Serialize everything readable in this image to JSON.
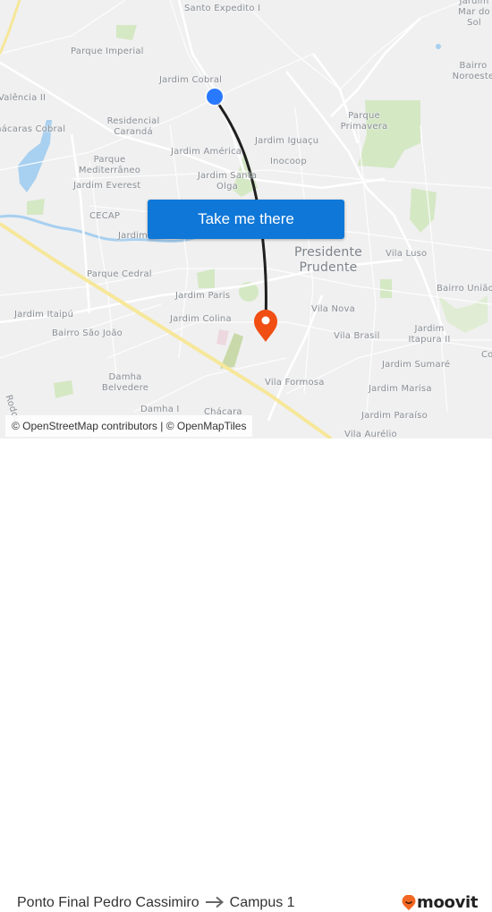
{
  "map": {
    "labels": [
      {
        "text": "Santo Expedito I",
        "kind": "suburb"
      },
      {
        "text": "Jardim Mar do Sol",
        "kind": "suburb"
      },
      {
        "text": "Parque Imperial",
        "kind": "suburb"
      },
      {
        "text": "Bairro Noroeste",
        "kind": "suburb"
      },
      {
        "text": "Jardim Cobral",
        "kind": "suburb"
      },
      {
        "text": "Valência II",
        "kind": "suburb"
      },
      {
        "text": "Residencial Carandá",
        "kind": "suburb"
      },
      {
        "text": "Chácaras Cobral",
        "kind": "suburb"
      },
      {
        "text": "Parque Primavera",
        "kind": "suburb"
      },
      {
        "text": "Jardim Iguaçu",
        "kind": "suburb"
      },
      {
        "text": "Jardim América",
        "kind": "suburb"
      },
      {
        "text": "Parque Mediterrâneo",
        "kind": "suburb"
      },
      {
        "text": "Inocoop",
        "kind": "suburb"
      },
      {
        "text": "Jardim Everest",
        "kind": "suburb"
      },
      {
        "text": "Jardim Santa Olga",
        "kind": "suburb"
      },
      {
        "text": "CECAP",
        "kind": "suburb"
      },
      {
        "text": "Jardim",
        "kind": "suburb"
      },
      {
        "text": "Presidente Prudente",
        "kind": "city"
      },
      {
        "text": "Vila Luso",
        "kind": "suburb"
      },
      {
        "text": "Parque Cedral",
        "kind": "suburb"
      },
      {
        "text": "Bairro União",
        "kind": "suburb"
      },
      {
        "text": "Jardim Paris",
        "kind": "suburb"
      },
      {
        "text": "Jardim Itaipú",
        "kind": "suburb"
      },
      {
        "text": "Jardim Colina",
        "kind": "suburb"
      },
      {
        "text": "Vila Nova",
        "kind": "suburb"
      },
      {
        "text": "Jardim Itapura II",
        "kind": "suburb"
      },
      {
        "text": "Bairro São João",
        "kind": "suburb"
      },
      {
        "text": "Vila Brasil",
        "kind": "suburb"
      },
      {
        "text": "Co",
        "kind": "suburb"
      },
      {
        "text": "Jardim Sumaré",
        "kind": "suburb"
      },
      {
        "text": "Damha Belvedere",
        "kind": "suburb"
      },
      {
        "text": "Vila Formosa",
        "kind": "suburb"
      },
      {
        "text": "Jardim Marisa",
        "kind": "suburb"
      },
      {
        "text": "Rodov",
        "kind": "road"
      },
      {
        "text": "Damha I",
        "kind": "suburb"
      },
      {
        "text": "Chácara",
        "kind": "suburb"
      },
      {
        "text": "Jardim Paraíso",
        "kind": "suburb"
      },
      {
        "text": "Vila Aurélio",
        "kind": "suburb"
      }
    ],
    "origin_marker": {
      "name": "Ponto Final Pedro Cassimiro",
      "color": "#2979ff"
    },
    "destination_marker": {
      "name": "Campus 1",
      "color": "#f04e12"
    },
    "route_color": "#1f1f1f",
    "colors": {
      "land": "#f0f0f0",
      "road": "#ffffff",
      "highway": "#f6e79a",
      "water": "#a8d0f0",
      "park": "#d4e8c4"
    }
  },
  "cta": {
    "label": "Take me there",
    "color": "#0f77d8"
  },
  "attribution": {
    "text": "© OpenStreetMap contributors | © OpenMapTiles"
  },
  "footer": {
    "origin": "Ponto Final Pedro Cassimiro",
    "arrow_icon": "arrow-right-icon",
    "destination": "Campus 1",
    "brand": "moovit",
    "brand_color": "#f26722"
  }
}
